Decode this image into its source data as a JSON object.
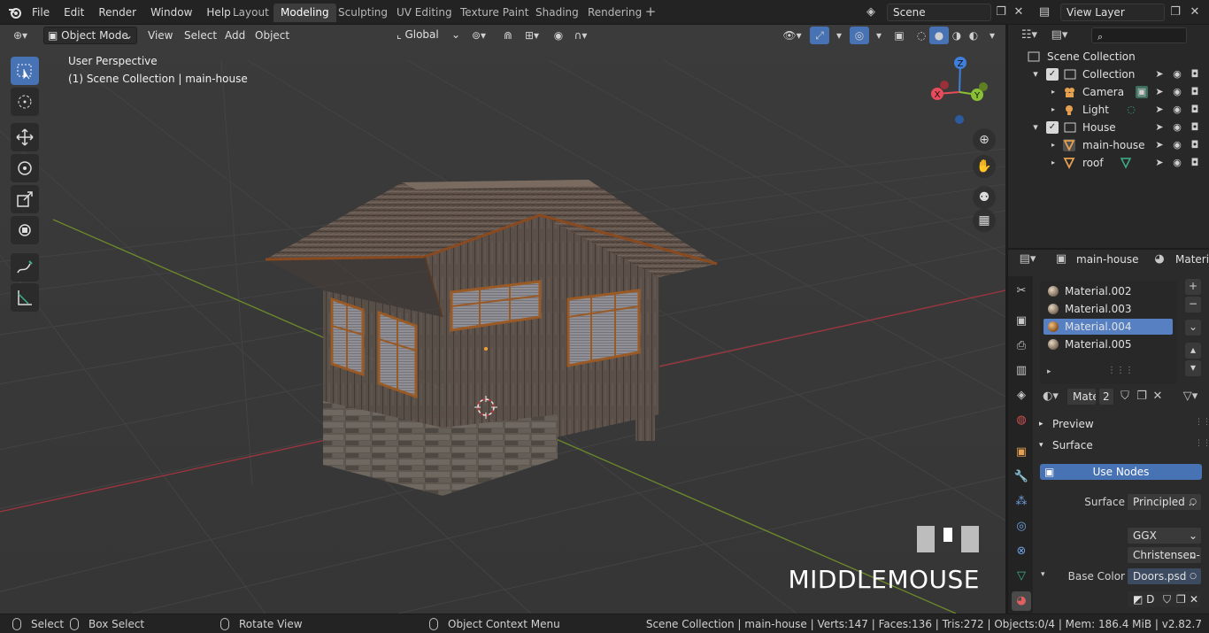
{
  "menu": {
    "items": [
      "File",
      "Edit",
      "Render",
      "Window",
      "Help"
    ]
  },
  "workspaces": {
    "tabs": [
      "Layout",
      "Modeling",
      "Sculpting",
      "UV Editing",
      "Texture Paint",
      "Shading",
      "Rendering"
    ],
    "active": "Modeling"
  },
  "scene": {
    "name": "Scene",
    "view_layer": "View Layer"
  },
  "viewport_header": {
    "mode": "Object Mode",
    "view": "View",
    "select": "Select",
    "add": "Add",
    "object": "Object",
    "orientation": "Global"
  },
  "viewport": {
    "perspective_label": "User Perspective",
    "collection_label": "(1) Scene Collection | main-house",
    "key_overlay": "MIDDLEMOUSE",
    "gizmo": {
      "x": "X",
      "y": "Y",
      "z": "Z"
    }
  },
  "outliner": {
    "root": "Scene Collection",
    "rows": [
      {
        "label": "Collection"
      },
      {
        "label": "Camera"
      },
      {
        "label": "Light"
      },
      {
        "label": "House"
      },
      {
        "label": "main-house"
      },
      {
        "label": "roof"
      }
    ]
  },
  "properties": {
    "object_name": "main-house",
    "context_tab": "Materia",
    "materials": [
      "Material.002",
      "Material.003",
      "Material.004",
      "Material.005"
    ],
    "selected_material": "Material.004",
    "slot_field": "Mate",
    "user_count": "2",
    "preview_label": "Preview",
    "surface_panel": "Surface",
    "use_nodes_label": "Use Nodes",
    "surface_label": "Surface",
    "surface_value": "Principled ..",
    "distribution": "GGX",
    "subsurface_method": "Christensen-...",
    "base_color_label": "Base Color",
    "base_color_value": "Doors.psd",
    "image_field": "D"
  },
  "statusbar": {
    "select": "Select",
    "box_select": "Box Select",
    "rotate_view": "Rotate View",
    "context_menu": "Object Context Menu",
    "stats": "Scene Collection | main-house | Verts:147 | Faces:136 | Tris:272 | Objects:0/4 | Mem: 186.4 MiB | v2.82.7"
  },
  "colors": {
    "accent": "#4772b3",
    "selected_material": "#5680c2",
    "background": "#393939",
    "axis_x": "#e84b5c",
    "axis_y": "#8ac034",
    "axis_z": "#3f7fdc"
  }
}
